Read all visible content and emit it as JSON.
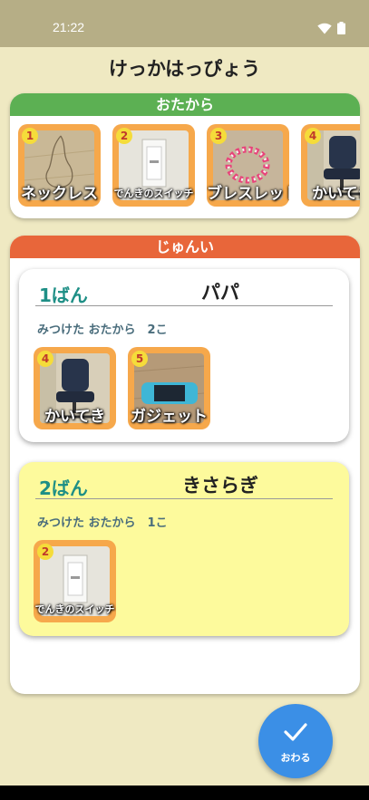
{
  "status_bar": {
    "time": "21:22",
    "icons": [
      "wifi-icon",
      "battery-icon"
    ]
  },
  "page": {
    "title": "けっかはっぴょう"
  },
  "treasure": {
    "header": "おたから",
    "header_color": "#5cb053",
    "items": [
      {
        "number": "1",
        "label": "ネックレス",
        "photo": "necklace"
      },
      {
        "number": "2",
        "label": "でんきのスイッチ",
        "photo": "switch"
      },
      {
        "number": "3",
        "label": "ブレスレット",
        "photo": "bracelet"
      },
      {
        "number": "4",
        "label": "かいてき",
        "photo": "chair"
      }
    ]
  },
  "ranking": {
    "header": "じゅんい",
    "header_color": "#e8663a",
    "entries": [
      {
        "place": "1ばん",
        "name": "パパ",
        "found_text": "みつけた おたから　2こ",
        "background": "#ffffff",
        "items": [
          {
            "number": "4",
            "label": "かいてき",
            "photo": "chair"
          },
          {
            "number": "5",
            "label": "ガジェット",
            "photo": "gadget"
          }
        ]
      },
      {
        "place": "2ばん",
        "name": "きさらぎ",
        "found_text": "みつけた おたから　1こ",
        "background": "#fdfa9c",
        "items": [
          {
            "number": "2",
            "label": "でんきのスイッチ",
            "photo": "switch"
          }
        ]
      }
    ]
  },
  "finish_button": {
    "label": "おわる",
    "icon": "check-icon",
    "color": "#3b8fe6"
  }
}
